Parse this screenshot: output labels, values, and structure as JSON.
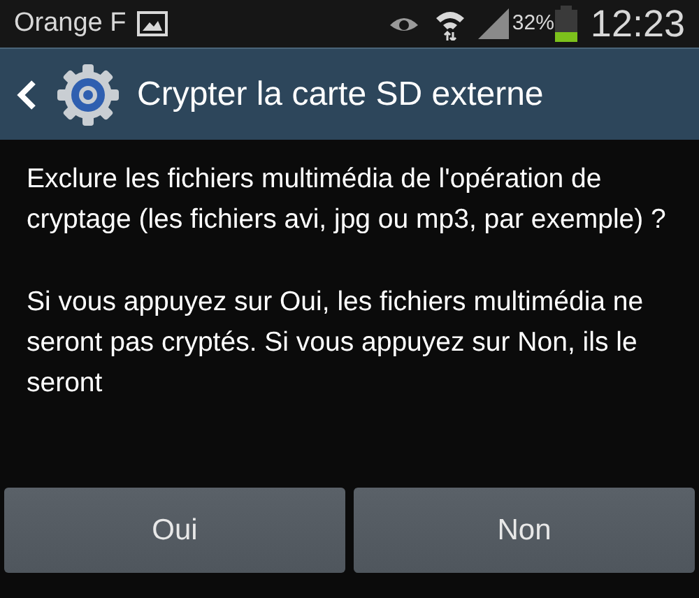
{
  "status_bar": {
    "carrier": "Orange F",
    "battery": "32%",
    "time": "12:23"
  },
  "action_bar": {
    "title": "Crypter la carte SD externe"
  },
  "paragraphs": [
    "Exclure les fichiers multimédia de l'opération de cryptage (les fichiers avi, jpg ou mp3, par exemple) ?",
    "Si vous appuyez sur Oui, les fichiers multimédia ne seront pas cryptés. Si vous appuyez sur Non, ils le seront"
  ],
  "buttons": [
    "Oui",
    "Non"
  ]
}
